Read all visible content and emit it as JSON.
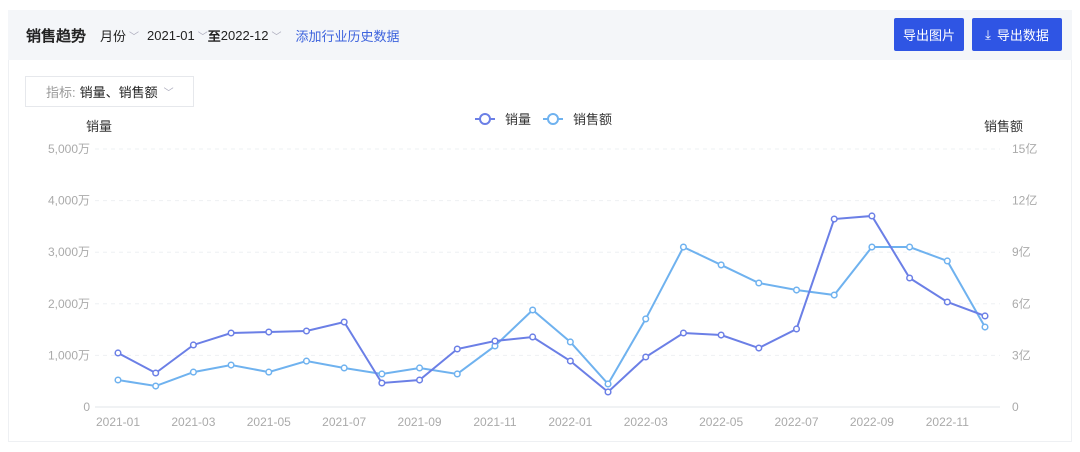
{
  "header": {
    "title": "销售趋势",
    "granularity": "月份",
    "start": "2021-01",
    "sep": "至",
    "end": "2022-12",
    "add_link": "添加行业历史数据",
    "export_image": "导出图片",
    "export_data": "导出数据",
    "download_icon": "download-icon"
  },
  "indicator": {
    "label": "指标:",
    "value": "销量、销售额"
  },
  "colors": {
    "accent": "#2f55e4",
    "series1": "#6b7fe6",
    "series2": "#6fb2ef"
  },
  "chart_data": {
    "type": "line",
    "legend": [
      "销量",
      "销售额"
    ],
    "legend_position": "top-center",
    "ylabel_left": "销量",
    "ylabel_right": "销售额",
    "x": [
      "2021-01",
      "2021-02",
      "2021-03",
      "2021-04",
      "2021-05",
      "2021-06",
      "2021-07",
      "2021-08",
      "2021-09",
      "2021-10",
      "2021-11",
      "2021-12",
      "2022-01",
      "2022-02",
      "2022-03",
      "2022-04",
      "2022-05",
      "2022-06",
      "2022-07",
      "2022-08",
      "2022-09",
      "2022-10",
      "2022-11",
      "2022-12"
    ],
    "xticks": [
      "2021-01",
      "2021-03",
      "2021-05",
      "2021-07",
      "2021-09",
      "2021-11",
      "2022-01",
      "2022-03",
      "2022-05",
      "2022-07",
      "2022-09",
      "2022-11"
    ],
    "yticks_left": [
      "0",
      "1,000万",
      "2,000万",
      "3,000万",
      "4,000万",
      "5,000万"
    ],
    "yticks_right": [
      "0",
      "3亿",
      "6亿",
      "9亿",
      "12亿",
      "15亿"
    ],
    "ylim_left": [
      0,
      5000
    ],
    "ylim_right": [
      0,
      15
    ],
    "series": [
      {
        "name": "销量",
        "unit": "万",
        "axis": "left",
        "values": [
          1047,
          659,
          1202,
          1434,
          1453,
          1473,
          1647,
          465,
          523,
          1124,
          1279,
          1357,
          891,
          291,
          969,
          1434,
          1395,
          1143,
          1512,
          3643,
          3702,
          2500,
          2035,
          1764
        ]
      },
      {
        "name": "销售额",
        "unit": "亿",
        "axis": "right",
        "values": [
          1.57,
          1.22,
          2.03,
          2.44,
          2.03,
          2.67,
          2.27,
          1.92,
          2.27,
          1.92,
          3.55,
          5.64,
          3.78,
          1.34,
          5.12,
          9.3,
          8.26,
          7.21,
          6.8,
          6.51,
          9.3,
          9.3,
          8.49,
          4.65
        ]
      }
    ]
  }
}
